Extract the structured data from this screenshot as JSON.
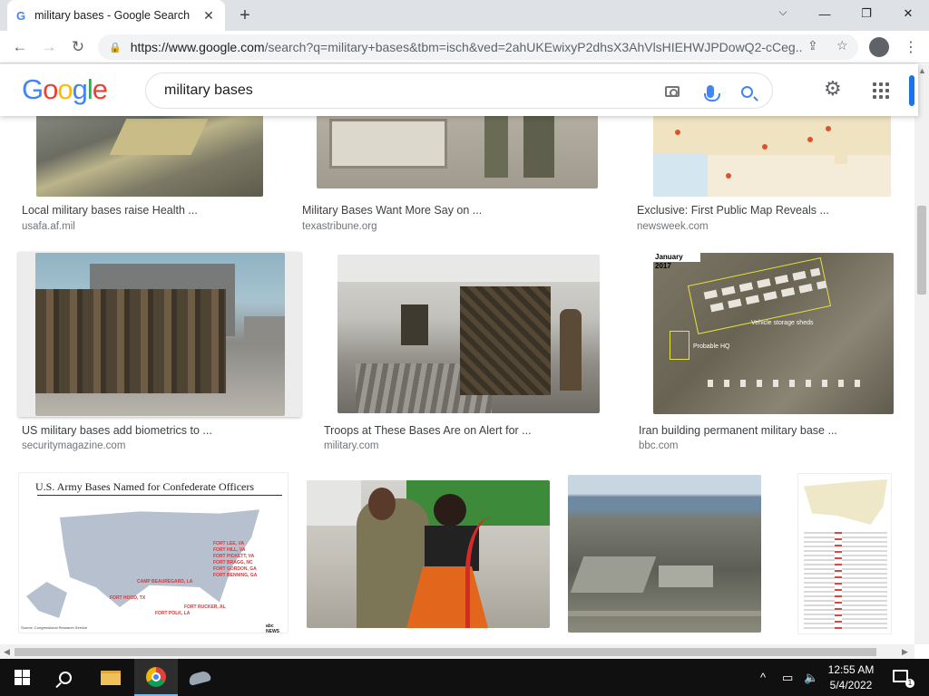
{
  "browser": {
    "tab_title": "military bases - Google Search",
    "tab_favicon": "G",
    "url_prefix": "https://www.google.com",
    "url_rest": "/search?q=military+bases&tbm=isch&ved=2ahUKEwixyP2dhsX3AhVlsHIEHWJPDowQ2-cCeg..."
  },
  "google": {
    "logo_letters": [
      "G",
      "o",
      "o",
      "g",
      "l",
      "e"
    ],
    "logo_colors": [
      "#4285f4",
      "#ea4335",
      "#fbbc05",
      "#4285f4",
      "#34a853",
      "#ea4335"
    ],
    "query": "military bases"
  },
  "results": [
    {
      "caption": "Local military bases raise Health ...",
      "source": "usafa.af.mil"
    },
    {
      "caption": "Military Bases Want More Say on ...",
      "source": "texastribune.org"
    },
    {
      "caption": "Exclusive: First Public Map Reveals ...",
      "source": "newsweek.com"
    },
    {
      "caption": "US military bases add biometrics to ...",
      "source": "securitymagazine.com"
    },
    {
      "caption": "Troops at These Bases Are on Alert for ...",
      "source": "military.com"
    },
    {
      "caption": "Iran building permanent military base ...",
      "source": "bbc.com"
    }
  ],
  "thumb_texts": {
    "satellite_year": "January 2017",
    "satellite_label1": "Vehicle storage sheds",
    "satellite_label2": "Probable HQ",
    "army_map_title": "U.S. Army Bases Named for Confederate Officers",
    "army_map_source": "Source: Congressional Research Service",
    "army_map_labels": [
      "FORT LEE, VA",
      "FORT HILL, VA",
      "FORT PICKETT, VA",
      "FORT BRAGG, NC",
      "FORT GORDON, GA",
      "FORT BENNING, GA",
      "CAMP BEAUREGARD, LA",
      "FORT HOOD, TX",
      "FORT RUCKER, AL",
      "FORT POLK, LA"
    ],
    "army_map_brand": "abc NEWS"
  },
  "taskbar": {
    "time": "12:55 AM",
    "date": "5/4/2022",
    "notifications": "1"
  }
}
